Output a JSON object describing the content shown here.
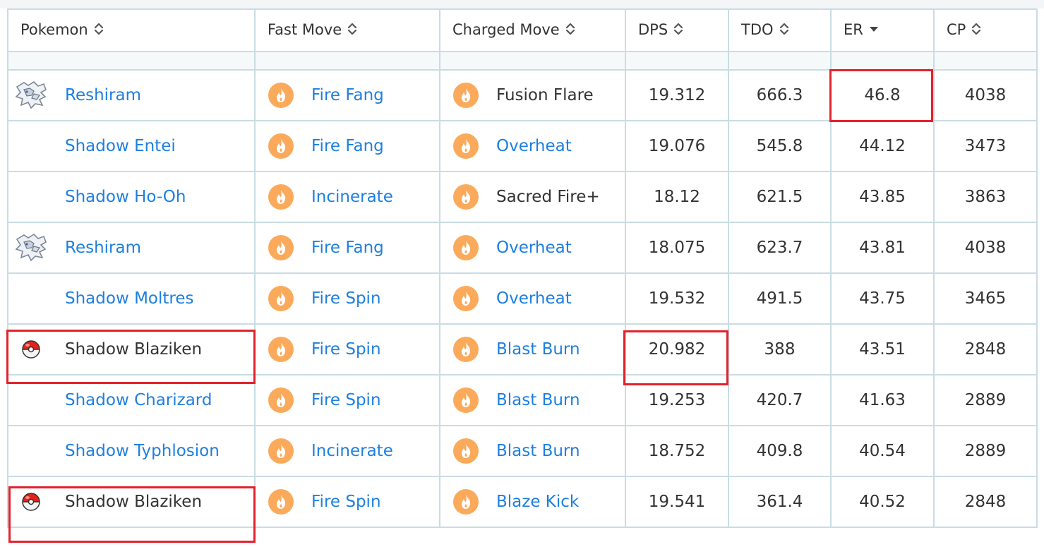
{
  "table": {
    "headers": [
      {
        "label": "Pokemon",
        "sort": "both"
      },
      {
        "label": "Fast Move",
        "sort": "both"
      },
      {
        "label": "Charged Move",
        "sort": "both"
      },
      {
        "label": "DPS",
        "sort": "both"
      },
      {
        "label": "TDO",
        "sort": "both"
      },
      {
        "label": "ER",
        "sort": "desc"
      },
      {
        "label": "CP",
        "sort": "both"
      }
    ],
    "rows": [
      {
        "pokemon": "Reshiram",
        "pokemon_icon": "reshiram-sprite-icon",
        "pokemon_link": true,
        "fast": "Fire Fang",
        "fast_link": true,
        "charged": "Fusion Flare",
        "charged_link": false,
        "dps": "19.312",
        "tdo": "666.3",
        "er": "46.8",
        "cp": "4038"
      },
      {
        "pokemon": "Shadow Entei",
        "pokemon_icon": "",
        "pokemon_link": true,
        "fast": "Fire Fang",
        "fast_link": true,
        "charged": "Overheat",
        "charged_link": true,
        "dps": "19.076",
        "tdo": "545.8",
        "er": "44.12",
        "cp": "3473"
      },
      {
        "pokemon": "Shadow Ho-Oh",
        "pokemon_icon": "",
        "pokemon_link": true,
        "fast": "Incinerate",
        "fast_link": true,
        "charged": "Sacred Fire+",
        "charged_link": false,
        "dps": "18.12",
        "tdo": "621.5",
        "er": "43.85",
        "cp": "3863"
      },
      {
        "pokemon": "Reshiram",
        "pokemon_icon": "reshiram-sprite-icon",
        "pokemon_link": true,
        "fast": "Fire Fang",
        "fast_link": true,
        "charged": "Overheat",
        "charged_link": true,
        "dps": "18.075",
        "tdo": "623.7",
        "er": "43.81",
        "cp": "4038"
      },
      {
        "pokemon": "Shadow Moltres",
        "pokemon_icon": "",
        "pokemon_link": true,
        "fast": "Fire Spin",
        "fast_link": true,
        "charged": "Overheat",
        "charged_link": true,
        "dps": "19.532",
        "tdo": "491.5",
        "er": "43.75",
        "cp": "3465"
      },
      {
        "pokemon": "Shadow Blaziken",
        "pokemon_icon": "pokeball-icon",
        "pokemon_link": false,
        "fast": "Fire Spin",
        "fast_link": true,
        "charged": "Blast Burn",
        "charged_link": true,
        "dps": "20.982",
        "tdo": "388",
        "er": "43.51",
        "cp": "2848"
      },
      {
        "pokemon": "Shadow Charizard",
        "pokemon_icon": "",
        "pokemon_link": true,
        "fast": "Fire Spin",
        "fast_link": true,
        "charged": "Blast Burn",
        "charged_link": true,
        "dps": "19.253",
        "tdo": "420.7",
        "er": "41.63",
        "cp": "2889"
      },
      {
        "pokemon": "Shadow Typhlosion",
        "pokemon_icon": "",
        "pokemon_link": true,
        "fast": "Incinerate",
        "fast_link": true,
        "charged": "Blast Burn",
        "charged_link": true,
        "dps": "18.752",
        "tdo": "409.8",
        "er": "40.54",
        "cp": "2889"
      },
      {
        "pokemon": "Shadow Blaziken",
        "pokemon_icon": "pokeball-icon",
        "pokemon_link": false,
        "fast": "Fire Spin",
        "fast_link": true,
        "charged": "Blaze Kick",
        "charged_link": true,
        "dps": "19.541",
        "tdo": "361.4",
        "er": "40.52",
        "cp": "2848"
      }
    ]
  },
  "move_type_icon": "fire-type-icon",
  "colors": {
    "link": "#1e7fe0",
    "text": "#333333",
    "border": "#c9dce3",
    "fire_badge": "#fbaa5b",
    "highlight": "#e3222b"
  }
}
